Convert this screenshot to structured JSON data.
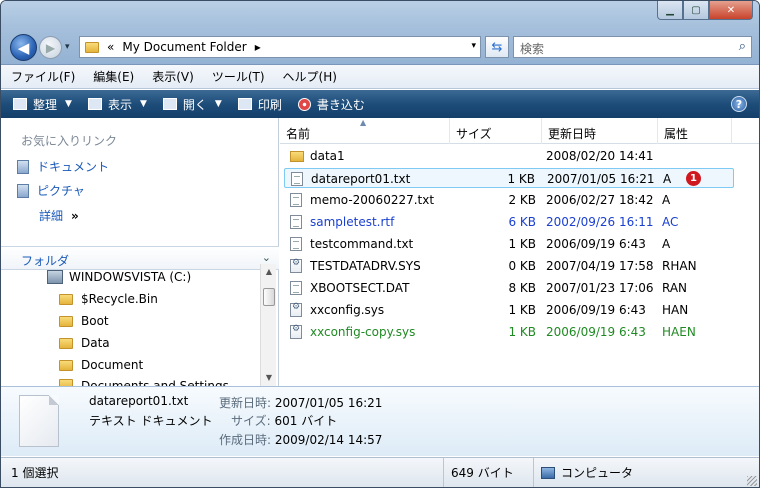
{
  "window": {
    "min_label": "▁",
    "max_label": "▢",
    "close_label": "✕"
  },
  "navigation": {
    "back_icon": "◀",
    "forward_icon": "▶",
    "history_icon": "▾",
    "breadcrumb_prefix": "«",
    "address": "My Document Folder",
    "separator": "▸",
    "dropdown_icon": "▾",
    "refresh_icon": "⇆",
    "search_placeholder": "検索",
    "search_icon": "⌕"
  },
  "menu": [
    "ファイル(F)",
    "編集(E)",
    "表示(V)",
    "ツール(T)",
    "ヘルプ(H)"
  ],
  "toolbar": {
    "organize": "整理",
    "view": "表示",
    "open": "開く",
    "print": "印刷",
    "burn": "書き込む",
    "help": "?"
  },
  "nav_pane": {
    "favorites_header": "お気に入りリンク",
    "favorites": [
      "ドキュメント",
      "ピクチャ"
    ],
    "more_label": "詳細",
    "more_icon": "»",
    "folders_header": "フォルダ",
    "folders_chevron": "⌄",
    "tree": [
      {
        "label": "WINDOWSVISTA (C:)",
        "type": "drive"
      },
      {
        "label": "$Recycle.Bin",
        "type": "folder"
      },
      {
        "label": "Boot",
        "type": "folder"
      },
      {
        "label": "Data",
        "type": "folder"
      },
      {
        "label": "Document",
        "type": "folder"
      },
      {
        "label": "Documents and Settings",
        "type": "folder"
      }
    ]
  },
  "file_list": {
    "columns": [
      "名前",
      "サイズ",
      "更新日時",
      "属性"
    ],
    "sort_icon": "▲",
    "rows": [
      {
        "name": "data1",
        "size": "",
        "date": "2008/02/20 14:41",
        "attr": "",
        "icon": "folder",
        "color": "#000000"
      },
      {
        "name": "datareport01.txt",
        "size": "1 KB",
        "date": "2007/01/05 16:21",
        "attr": "A",
        "icon": "txt",
        "color": "#000000",
        "selected": true,
        "badge": "1"
      },
      {
        "name": "memo-20060227.txt",
        "size": "2 KB",
        "date": "2006/02/27 18:42",
        "attr": "A",
        "icon": "txt",
        "color": "#000000"
      },
      {
        "name": "sampletest.rtf",
        "size": "6 KB",
        "date": "2002/09/26 16:11",
        "attr": "AC",
        "icon": "txt",
        "color": "#1a3fd0"
      },
      {
        "name": "testcommand.txt",
        "size": "1 KB",
        "date": "2006/09/19 6:43",
        "attr": "A",
        "icon": "txt",
        "color": "#000000"
      },
      {
        "name": "TESTDATADRV.SYS",
        "size": "0 KB",
        "date": "2007/04/19 17:58",
        "attr": "RHAN",
        "icon": "sys",
        "color": "#000000"
      },
      {
        "name": "XBOOTSECT.DAT",
        "size": "8 KB",
        "date": "2007/01/23 17:06",
        "attr": "RAN",
        "icon": "txt",
        "color": "#000000"
      },
      {
        "name": "xxconfig.sys",
        "size": "1 KB",
        "date": "2006/09/19 6:43",
        "attr": "HAN",
        "icon": "sys",
        "color": "#000000"
      },
      {
        "name": "xxconfig-copy.sys",
        "size": "1 KB",
        "date": "2006/09/19 6:43",
        "attr": "HAEN",
        "icon": "sys",
        "color": "#1f8a22"
      }
    ]
  },
  "details": {
    "filename": "datareport01.txt",
    "type": "テキスト ドキュメント",
    "modified_key": "更新日時:",
    "modified_val": "2007/01/05 16:21",
    "size_key": "サイズ:",
    "size_val": "601 バイト",
    "created_key": "作成日時:",
    "created_val": "2009/02/14 14:57"
  },
  "status": {
    "count": "1 個選択",
    "size": "649 バイト",
    "location": "コンピュータ"
  }
}
